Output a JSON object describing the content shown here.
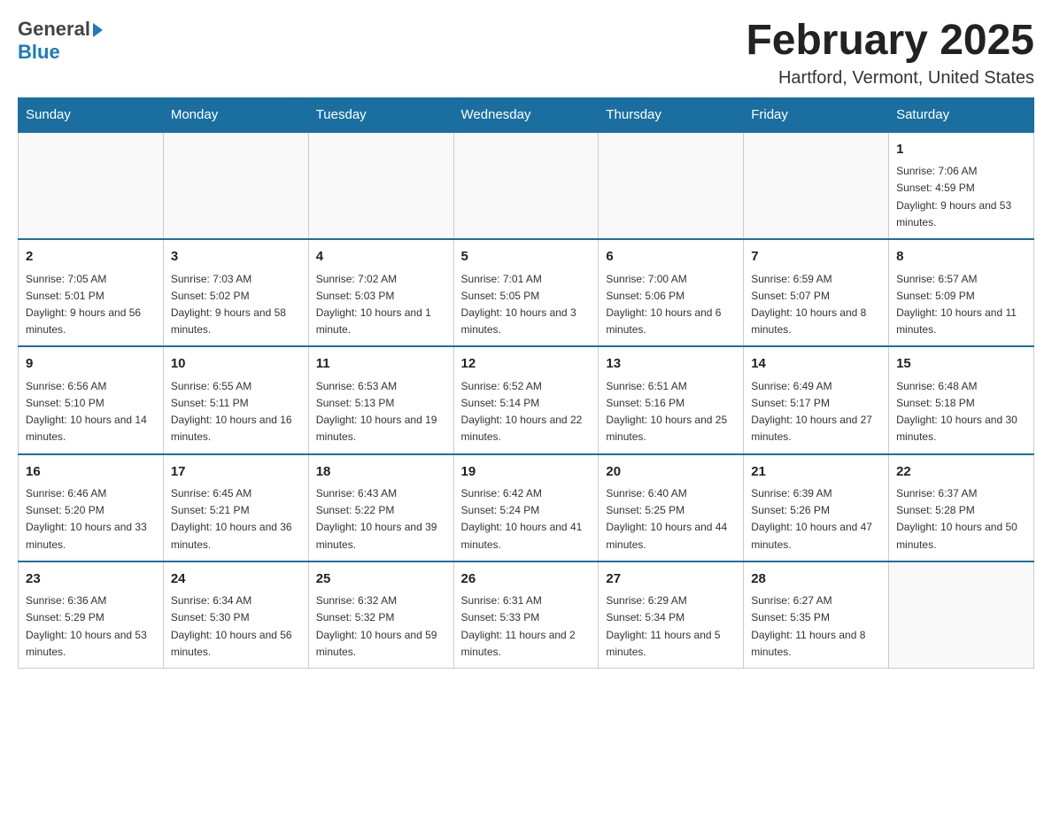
{
  "header": {
    "month_title": "February 2025",
    "location": "Hartford, Vermont, United States",
    "logo_general": "General",
    "logo_blue": "Blue"
  },
  "days_of_week": [
    "Sunday",
    "Monday",
    "Tuesday",
    "Wednesday",
    "Thursday",
    "Friday",
    "Saturday"
  ],
  "weeks": [
    {
      "days": [
        {
          "date": "",
          "info": ""
        },
        {
          "date": "",
          "info": ""
        },
        {
          "date": "",
          "info": ""
        },
        {
          "date": "",
          "info": ""
        },
        {
          "date": "",
          "info": ""
        },
        {
          "date": "",
          "info": ""
        },
        {
          "date": "1",
          "info": "Sunrise: 7:06 AM\nSunset: 4:59 PM\nDaylight: 9 hours and 53 minutes."
        }
      ]
    },
    {
      "days": [
        {
          "date": "2",
          "info": "Sunrise: 7:05 AM\nSunset: 5:01 PM\nDaylight: 9 hours and 56 minutes."
        },
        {
          "date": "3",
          "info": "Sunrise: 7:03 AM\nSunset: 5:02 PM\nDaylight: 9 hours and 58 minutes."
        },
        {
          "date": "4",
          "info": "Sunrise: 7:02 AM\nSunset: 5:03 PM\nDaylight: 10 hours and 1 minute."
        },
        {
          "date": "5",
          "info": "Sunrise: 7:01 AM\nSunset: 5:05 PM\nDaylight: 10 hours and 3 minutes."
        },
        {
          "date": "6",
          "info": "Sunrise: 7:00 AM\nSunset: 5:06 PM\nDaylight: 10 hours and 6 minutes."
        },
        {
          "date": "7",
          "info": "Sunrise: 6:59 AM\nSunset: 5:07 PM\nDaylight: 10 hours and 8 minutes."
        },
        {
          "date": "8",
          "info": "Sunrise: 6:57 AM\nSunset: 5:09 PM\nDaylight: 10 hours and 11 minutes."
        }
      ]
    },
    {
      "days": [
        {
          "date": "9",
          "info": "Sunrise: 6:56 AM\nSunset: 5:10 PM\nDaylight: 10 hours and 14 minutes."
        },
        {
          "date": "10",
          "info": "Sunrise: 6:55 AM\nSunset: 5:11 PM\nDaylight: 10 hours and 16 minutes."
        },
        {
          "date": "11",
          "info": "Sunrise: 6:53 AM\nSunset: 5:13 PM\nDaylight: 10 hours and 19 minutes."
        },
        {
          "date": "12",
          "info": "Sunrise: 6:52 AM\nSunset: 5:14 PM\nDaylight: 10 hours and 22 minutes."
        },
        {
          "date": "13",
          "info": "Sunrise: 6:51 AM\nSunset: 5:16 PM\nDaylight: 10 hours and 25 minutes."
        },
        {
          "date": "14",
          "info": "Sunrise: 6:49 AM\nSunset: 5:17 PM\nDaylight: 10 hours and 27 minutes."
        },
        {
          "date": "15",
          "info": "Sunrise: 6:48 AM\nSunset: 5:18 PM\nDaylight: 10 hours and 30 minutes."
        }
      ]
    },
    {
      "days": [
        {
          "date": "16",
          "info": "Sunrise: 6:46 AM\nSunset: 5:20 PM\nDaylight: 10 hours and 33 minutes."
        },
        {
          "date": "17",
          "info": "Sunrise: 6:45 AM\nSunset: 5:21 PM\nDaylight: 10 hours and 36 minutes."
        },
        {
          "date": "18",
          "info": "Sunrise: 6:43 AM\nSunset: 5:22 PM\nDaylight: 10 hours and 39 minutes."
        },
        {
          "date": "19",
          "info": "Sunrise: 6:42 AM\nSunset: 5:24 PM\nDaylight: 10 hours and 41 minutes."
        },
        {
          "date": "20",
          "info": "Sunrise: 6:40 AM\nSunset: 5:25 PM\nDaylight: 10 hours and 44 minutes."
        },
        {
          "date": "21",
          "info": "Sunrise: 6:39 AM\nSunset: 5:26 PM\nDaylight: 10 hours and 47 minutes."
        },
        {
          "date": "22",
          "info": "Sunrise: 6:37 AM\nSunset: 5:28 PM\nDaylight: 10 hours and 50 minutes."
        }
      ]
    },
    {
      "days": [
        {
          "date": "23",
          "info": "Sunrise: 6:36 AM\nSunset: 5:29 PM\nDaylight: 10 hours and 53 minutes."
        },
        {
          "date": "24",
          "info": "Sunrise: 6:34 AM\nSunset: 5:30 PM\nDaylight: 10 hours and 56 minutes."
        },
        {
          "date": "25",
          "info": "Sunrise: 6:32 AM\nSunset: 5:32 PM\nDaylight: 10 hours and 59 minutes."
        },
        {
          "date": "26",
          "info": "Sunrise: 6:31 AM\nSunset: 5:33 PM\nDaylight: 11 hours and 2 minutes."
        },
        {
          "date": "27",
          "info": "Sunrise: 6:29 AM\nSunset: 5:34 PM\nDaylight: 11 hours and 5 minutes."
        },
        {
          "date": "28",
          "info": "Sunrise: 6:27 AM\nSunset: 5:35 PM\nDaylight: 11 hours and 8 minutes."
        },
        {
          "date": "",
          "info": ""
        }
      ]
    }
  ]
}
